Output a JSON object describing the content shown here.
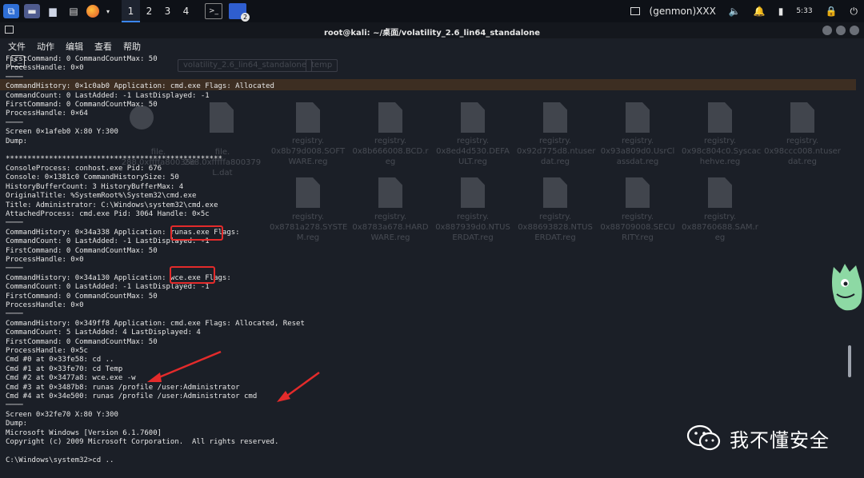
{
  "panel": {
    "workspaces": [
      "1",
      "2",
      "3",
      "4"
    ],
    "active_workspace": "1",
    "user_label": "(genmon)XXX",
    "clock": "5:33",
    "task_badge": "2"
  },
  "window": {
    "title": "root@kali: ~/桌面/volatility_2.6_lin64_standalone"
  },
  "menu": {
    "items": [
      "文件",
      "动作",
      "编辑",
      "查看",
      "帮助"
    ]
  },
  "ghost_fm": {
    "tabs": [
      "volatility_2.6_lin64_standalone",
      "temp"
    ],
    "files_row1": [
      "file.\n288.0xffffa80035e",
      "file.\n288.0xfffffa800379\nL.dat",
      "registry.\n0x8b79d008.SOFT\nWARE.reg",
      "registry.\n0x8b666008.BCD.r\neg",
      "registry.\n0x8ed4d530.DEFA\nULT.reg",
      "registry.\n0x92d775d8.ntuser\ndat.reg",
      "registry.\n0x93a809d0.UsrCl\nassdat.reg",
      "registry.\n0x98c804c0.Syscac\nhehve.reg",
      "registry.\n0x98ccc008.ntuser\ndat.reg"
    ],
    "files_row2": [
      "registry.\n0x8781a278.SYSTE\nM.reg",
      "registry.\n0x8783a678.HARD\nWARE.reg",
      "registry.\n0x887939d0.NTUS\nERDAT.reg",
      "registry.\n0x88693828.NTUS\nERDAT.reg",
      "registry.\n0x88709008.SECU\nRITY.reg",
      "registry.\n0x88760688.SAM.r\neg"
    ]
  },
  "terminal": {
    "lines": [
      "FirstCommand: 0 CommandCountMax: 50",
      "ProcessHandle: 0×0",
      "────",
      "CommandHistory: 0×1c0ab0 Application: cmd.exe Flags: Allocated",
      "CommandCount: 0 LastAdded: -1 LastDisplayed: -1",
      "FirstCommand: 0 CommandCountMax: 50",
      "ProcessHandle: 0×64",
      "────",
      "Screen 0×1afeb0 X:80 Y:300",
      "Dump:",
      "",
      "**************************************************",
      "ConsoleProcess: conhost.exe Pid: 676",
      "Console: 0×1381c0 CommandHistorySize: 50",
      "HistoryBufferCount: 3 HistoryBufferMax: 4",
      "OriginalTitle: %SystemRoot%\\System32\\cmd.exe",
      "Title: Administrator: C:\\Windows\\system32\\cmd.exe",
      "AttachedProcess: cmd.exe Pid: 3064 Handle: 0×5c",
      "────",
      "CommandHistory: 0×34a338 Application: runas.exe Flags:",
      "CommandCount: 0 LastAdded: -1 LastDisplayed: -1",
      "FirstCommand: 0 CommandCountMax: 50",
      "ProcessHandle: 0×0",
      "────",
      "CommandHistory: 0×34a130 Application: wce.exe Flags:",
      "CommandCount: 0 LastAdded: -1 LastDisplayed: -1",
      "FirstCommand: 0 CommandCountMax: 50",
      "ProcessHandle: 0×0",
      "────",
      "CommandHistory: 0×349ff8 Application: cmd.exe Flags: Allocated, Reset",
      "CommandCount: 5 LastAdded: 4 LastDisplayed: 4",
      "FirstCommand: 0 CommandCountMax: 50",
      "ProcessHandle: 0×5c",
      "Cmd #0 at 0×33fe58: cd ..",
      "Cmd #1 at 0×33fe70: cd Temp",
      "Cmd #2 at 0×3477a8: wce.exe -w",
      "Cmd #3 at 0×3487b8: runas /profile /user:Administrator",
      "Cmd #4 at 0×34e500: runas /profile /user:Administrator cmd",
      "────",
      "Screen 0×32fe70 X:80 Y:300",
      "Dump:",
      "Microsoft Windows [Version 6.1.7600]",
      "Copyright (c) 2009 Microsoft Corporation.  All rights reserved.",
      "",
      "C:\\Windows\\system32>cd .."
    ]
  },
  "watermark": {
    "text": "我不懂安全"
  },
  "colors": {
    "highlight_box": "#e42b2b",
    "band": "#3d2e22",
    "accent": "#3b86f7"
  }
}
